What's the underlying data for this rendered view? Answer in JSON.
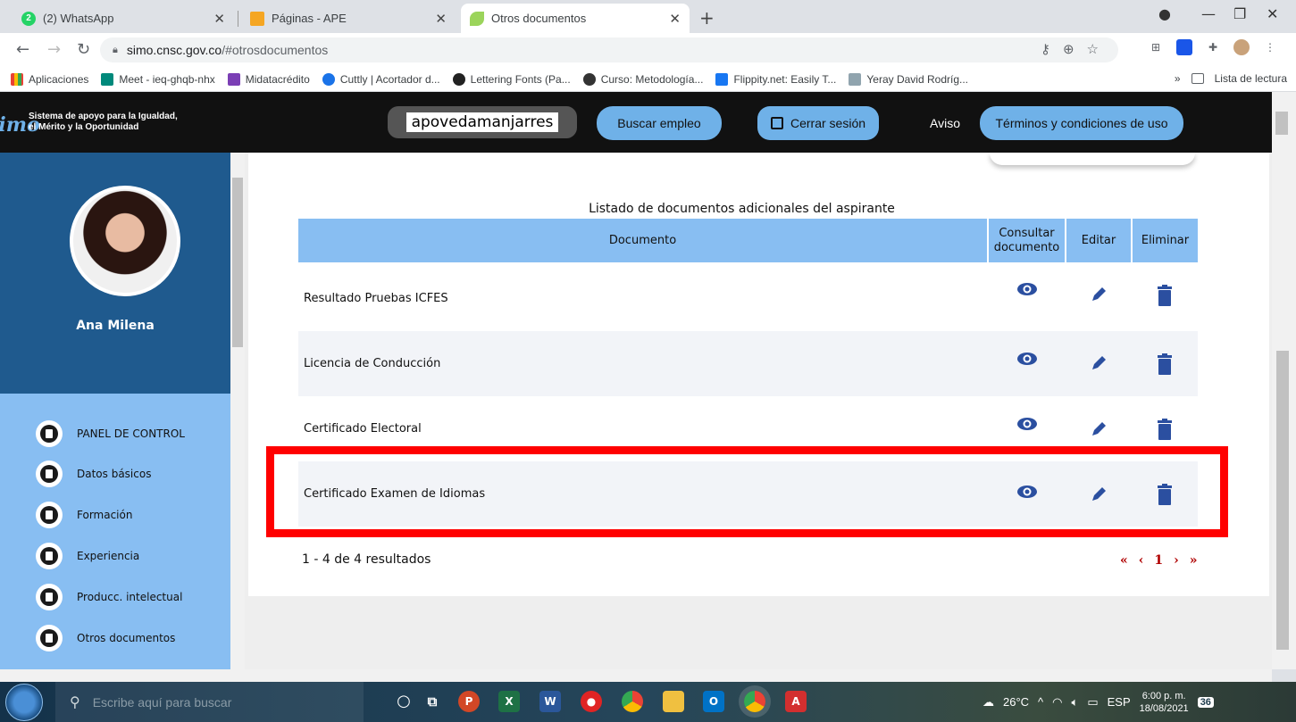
{
  "browser": {
    "tabs": [
      {
        "title": "(2) WhatsApp",
        "badge": "2"
      },
      {
        "title": "Páginas - APE"
      },
      {
        "title": "Otros documentos"
      }
    ],
    "url_host": "simo.cnsc.gov.co",
    "url_path": "/#otrosdocumentos",
    "new_tab": "+"
  },
  "bookmarks": [
    {
      "label": "Aplicaciones"
    },
    {
      "label": "Meet - ieq-ghqb-nhx"
    },
    {
      "label": "Midatacrédito"
    },
    {
      "label": "Cuttly | Acortador d..."
    },
    {
      "label": "Lettering Fonts (Pa..."
    },
    {
      "label": "Curso: Metodología..."
    },
    {
      "label": "Flippity.net: Easily T..."
    },
    {
      "label": "Yeray David Rodríg..."
    }
  ],
  "bookmarks_more": "»",
  "reading_list": "Lista de lectura",
  "header": {
    "logo_mark": "simo",
    "logo_line1": "Sistema de apoyo para la Igualdad,",
    "logo_line2": "el Mérito y la Oportunidad",
    "username": "apovedamanjarres",
    "buscar_empleo": "Buscar empleo",
    "cerrar_sesion": "Cerrar sesión",
    "aviso": "Aviso",
    "terminos": "Términos y condiciones de uso"
  },
  "sidebar": {
    "user_name": "Ana Milena",
    "menu": [
      {
        "label": "PANEL DE CONTROL"
      },
      {
        "label": "Datos básicos"
      },
      {
        "label": "Formación"
      },
      {
        "label": "Experiencia"
      },
      {
        "label": "Producc. intelectual"
      },
      {
        "label": "Otros documentos"
      }
    ]
  },
  "documents": {
    "title": "Listado de documentos adicionales del aspirante",
    "columns": {
      "documento": "Documento",
      "consultar_1": "Consultar",
      "consultar_2": "documento",
      "editar": "Editar",
      "eliminar": "Eliminar"
    },
    "rows": [
      {
        "name": "Resultado Pruebas ICFES"
      },
      {
        "name": "Licencia de Conducción"
      },
      {
        "name": "Certificado Electoral"
      },
      {
        "name": "Certificado Examen de Idiomas"
      }
    ],
    "results_text": "1 - 4 de 4 resultados",
    "pager": {
      "first": "«",
      "prev": "‹",
      "current": "1",
      "next": "›",
      "last": "»"
    }
  },
  "taskbar": {
    "search_placeholder": "Escribe aquí para buscar",
    "weather": "26°C",
    "language": "ESP",
    "time": "6:00 p. m.",
    "date": "18/08/2021",
    "notifications": "36"
  },
  "colors": {
    "accent_blue": "#88bef2",
    "header_blue": "#6fb1e8",
    "profile_blue": "#1f5a8e",
    "icon_blue": "#2b4fa0",
    "highlight_red": "#ff0000"
  }
}
